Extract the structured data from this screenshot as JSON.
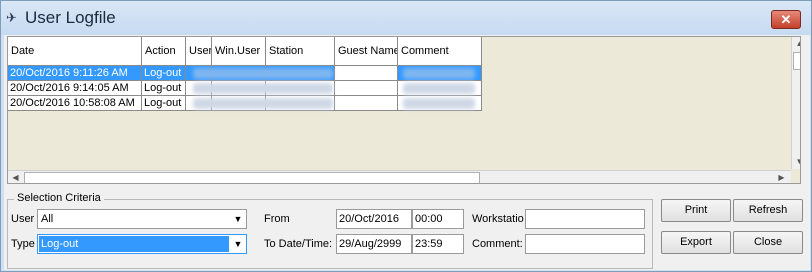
{
  "window": {
    "title": "User Logfile",
    "close_label": "✕"
  },
  "grid": {
    "columns": [
      "Date",
      "Action",
      "User",
      "Win.User",
      "Station",
      "Guest Name",
      "Comment"
    ],
    "rows": [
      {
        "date": "20/Oct/2016 9:11:26 AM",
        "action": "Log-out"
      },
      {
        "date": "20/Oct/2016 9:14:05 AM",
        "action": "Log-out"
      },
      {
        "date": "20/Oct/2016 10:58:08 AM",
        "action": "Log-out"
      }
    ]
  },
  "criteria": {
    "title": "Selection Criteria",
    "user_label": "User",
    "user_value": "All",
    "type_label": "Type",
    "type_value": "Log-out",
    "from_label": "From",
    "from_date": "20/Oct/2016",
    "from_time": "00:00",
    "to_label": "To Date/Time:",
    "to_date": "29/Aug/2999",
    "to_time": "23:59",
    "workstation_label": "Workstatio",
    "workstation_value": "",
    "comment_label": "Comment:",
    "comment_value": ""
  },
  "buttons": {
    "print": "Print",
    "refresh": "Refresh",
    "export": "Export",
    "close": "Close"
  }
}
